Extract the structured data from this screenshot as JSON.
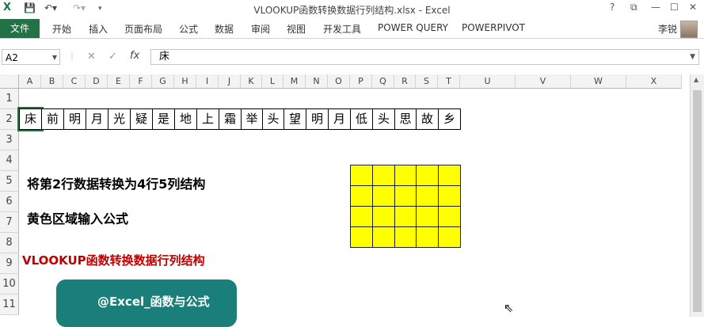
{
  "window": {
    "title": "VLOOKUP函数转换数据行列结构.xlsx - Excel",
    "controls": [
      "?",
      "⧉",
      "—",
      "☐",
      "✕"
    ]
  },
  "ribbon": {
    "file_tab": "文件",
    "tabs": [
      "开始",
      "插入",
      "页面布局",
      "公式",
      "数据",
      "审阅",
      "视图",
      "开发工具",
      "POWER QUERY",
      "POWERPIVOT"
    ],
    "user": "李锐"
  },
  "formula_bar": {
    "name_box": "A2",
    "content": "床"
  },
  "columns": [
    "A",
    "B",
    "C",
    "D",
    "E",
    "F",
    "G",
    "H",
    "I",
    "J",
    "K",
    "L",
    "M",
    "N",
    "O",
    "P",
    "Q",
    "R",
    "S",
    "T",
    "U",
    "V",
    "W",
    "X"
  ],
  "rows": [
    "1",
    "2",
    "3",
    "4",
    "5",
    "6",
    "7",
    "8",
    "9",
    "10",
    "11"
  ],
  "row2": [
    "床",
    "前",
    "明",
    "月",
    "光",
    "疑",
    "是",
    "地",
    "上",
    "霜",
    "举",
    "头",
    "望",
    "明",
    "月",
    "低",
    "头",
    "思",
    "故",
    "乡"
  ],
  "notes": {
    "convert": "将第2行数据转换为4行5列结构",
    "yellow": "黄色区域输入公式",
    "vlookup": "VLOOKUP函数转换数据行列结构"
  },
  "target_grid": {
    "rows": 4,
    "cols": 5,
    "fill": "#ffff00"
  },
  "banner": {
    "line1": "@Excel_函数与公式",
    "line2": ""
  },
  "colors": {
    "excel_green": "#217346",
    "accent_red": "#c00000",
    "banner_teal": "#1a7f7a"
  }
}
